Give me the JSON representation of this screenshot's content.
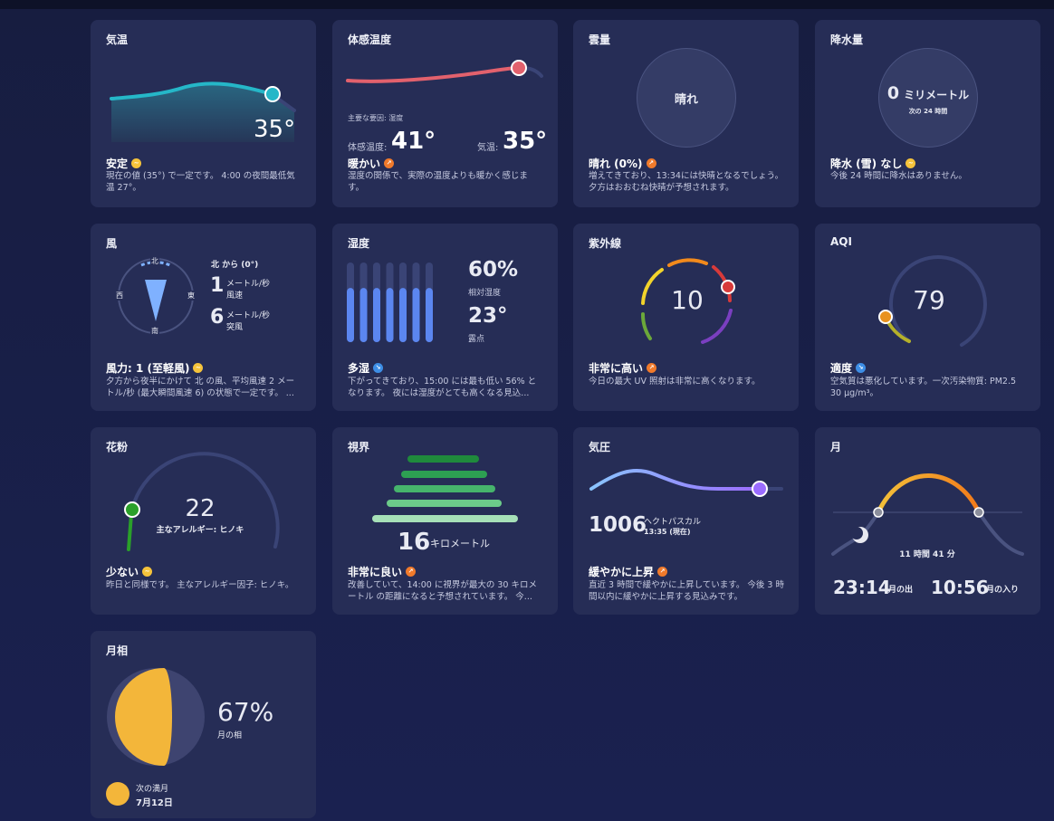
{
  "cards": {
    "temperature": {
      "title": "気温",
      "value": "35°",
      "summary": "安定",
      "desc": "現在の値 (35°) で一定です。 4:00 の夜間最低気温 27°。"
    },
    "feels_like": {
      "title": "体感温度",
      "factor_label": "主要な要因: 湿度",
      "feels_label": "体感温度:",
      "feels_value": "41°",
      "temp_label": "気温:",
      "temp_value": "35°",
      "summary": "暖かい",
      "desc": "湿度の関係で、実際の温度よりも暖かく感じます。"
    },
    "cloud": {
      "title": "雲量",
      "center": "晴れ",
      "summary": "晴れ (0%)",
      "desc": "増えてきており、13:34には快晴となるでしょう。 夕方はおおむね快晴が予想されます。"
    },
    "precip": {
      "title": "降水量",
      "amount": "0",
      "unit": "ミリメートル",
      "sub": "次の 24 時間",
      "summary": "降水 (雪) なし",
      "desc": "今後 24 時間に降水はありません。"
    },
    "wind": {
      "title": "風",
      "compass": {
        "n": "北",
        "s": "南",
        "e": "東",
        "w": "西"
      },
      "direction": "北 から (0°)",
      "speed": "1",
      "speed_unit": "メートル/秒",
      "speed_label": "風速",
      "gust": "6",
      "gust_unit": "メートル/秒",
      "gust_label": "突風",
      "summary": "風力: 1 (至軽風)",
      "desc": "夕方から夜半にかけて 北 の風、平均風速 2 メートル/秒 (最大瞬間風速 6) の状態で一定です。 ..."
    },
    "humidity": {
      "title": "湿度",
      "value": "60%",
      "value_label": "相対湿度",
      "dew": "23°",
      "dew_label": "露点",
      "bar_fill": [
        0.68,
        0.68,
        0.68,
        0.68,
        0.68,
        0.68,
        0.68
      ],
      "summary": "多湿",
      "desc": "下がってきており、15:00 には最も低い 56% となります。 夜には湿度がとても高くなる見込..."
    },
    "uv": {
      "title": "紫外線",
      "value": "10",
      "summary": "非常に高い",
      "desc": "今日の最大 UV 照射は非常に高くなります。"
    },
    "aqi": {
      "title": "AQI",
      "value": "79",
      "summary": "適度",
      "desc": "空気質は悪化しています。一次汚染物質: PM2.5 30 µg/m³。"
    },
    "pollen": {
      "title": "花粉",
      "value": "22",
      "allergen": "主なアレルギー: ヒノキ",
      "summary": "少ない",
      "desc": "昨日と同様です。 主なアレルギー因子: ヒノキ。"
    },
    "visibility": {
      "title": "視界",
      "value": "16",
      "unit": "キロメートル",
      "summary": "非常に良い",
      "desc": "改善していて、14:00 に視界が最大の 30 キロメートル の距離になると予想されています。 今..."
    },
    "pressure": {
      "title": "気圧",
      "value": "1006",
      "unit": "ヘクトパスカル",
      "time": "13:35 (現在)",
      "summary": "緩やかに上昇",
      "desc": "直近 3 時間で緩やかに上昇しています。 今後 3 時間以内に緩やかに上昇する見込みです。"
    },
    "moon": {
      "title": "月",
      "duration": "11 時間 41 分",
      "rise": "23:14",
      "rise_label": "月の出",
      "set": "10:56",
      "set_label": "月の入り"
    },
    "moon_phase": {
      "title": "月相",
      "value": "67%",
      "value_label": "月の相",
      "next_label": "次の満月",
      "next_date": "7月12日"
    }
  },
  "colors": {
    "card_bg": "#262d56",
    "temp_line": "#25b7c8",
    "feels_line": "#e2616d",
    "humidity_bar": "#5b86f0",
    "moon_orange": "#f28a1c",
    "moon_yellow": "#f3b63a"
  }
}
